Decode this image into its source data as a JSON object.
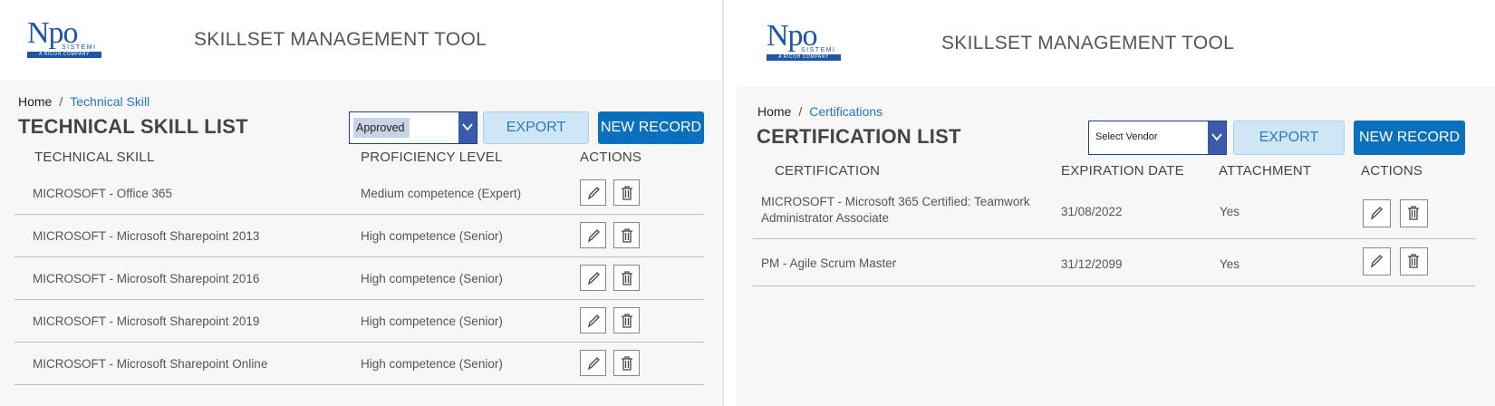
{
  "left": {
    "logo": {
      "main": "Npo",
      "sub": "SISTEMI",
      "tagline": "A RICOH COMPANY"
    },
    "app_title": "SKILLSET MANAGEMENT TOOL",
    "breadcrumb": {
      "home": "Home",
      "separator": "/",
      "current": "Technical Skill"
    },
    "page_title": "TECHNICAL SKILL LIST",
    "filter": {
      "selected": "Approved"
    },
    "export_label": "EXPORT",
    "new_record_label": "NEW RECORD",
    "columns": {
      "skill": "TECHNICAL SKILL",
      "level": "PROFICIENCY LEVEL",
      "actions": "ACTIONS"
    },
    "rows": [
      {
        "skill": "MICROSOFT - Office 365",
        "level": "Medium competence (Expert)"
      },
      {
        "skill": "MICROSOFT - Microsoft Sharepoint 2013",
        "level": "High competence (Senior)"
      },
      {
        "skill": "MICROSOFT - Microsoft Sharepoint 2016",
        "level": "High competence (Senior)"
      },
      {
        "skill": "MICROSOFT - Microsoft Sharepoint 2019",
        "level": "High competence (Senior)"
      },
      {
        "skill": "MICROSOFT - Microsoft Sharepoint Online",
        "level": "High competence (Senior)"
      }
    ]
  },
  "right": {
    "logo": {
      "main": "Npo",
      "sub": "SISTEMI",
      "tagline": "A RICOH COMPANY"
    },
    "app_title": "SKILLSET MANAGEMENT TOOL",
    "breadcrumb": {
      "home": "Home",
      "separator": "/",
      "current": "Certifications"
    },
    "page_title": "CERTIFICATION LIST",
    "filter": {
      "selected": "Select Vendor"
    },
    "export_label": "EXPORT",
    "new_record_label": "NEW RECORD",
    "columns": {
      "certification": "CERTIFICATION",
      "expiration": "EXPIRATION DATE",
      "attachment": "ATTACHMENT",
      "actions": "ACTIONS"
    },
    "rows": [
      {
        "cert_line1": "MICROSOFT  - Microsoft 365 Certified: Teamwork",
        "cert_line2": "Administrator Associate",
        "expiration": "31/08/2022",
        "attachment": "Yes"
      },
      {
        "cert_line1": "PM  - Agile Scrum Master",
        "cert_line2": "",
        "expiration": "31/12/2099",
        "attachment": "Yes"
      }
    ]
  },
  "icons": {
    "edit": "pencil-icon",
    "delete": "trash-icon",
    "dropdown": "chevron-down-icon"
  },
  "colors": {
    "brand_blue": "#1f55a6",
    "primary_button": "#0a6fbd",
    "export_button": "#cfe6f6",
    "link": "#2478c4"
  }
}
